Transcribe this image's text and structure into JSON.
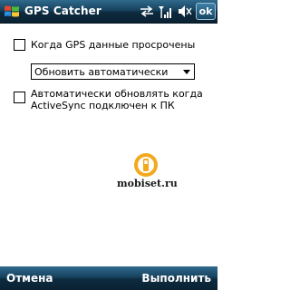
{
  "titlebar": {
    "title": "GPS Catcher",
    "ok_label": "ok",
    "icons": [
      "windows-start-icon",
      "connectivity-icon",
      "signal-icon",
      "volume-icon"
    ]
  },
  "options": {
    "gps_expired_label": "Когда GPS данные просрочены",
    "gps_expired_checked": false,
    "update_mode_selected": "Обновить автоматически",
    "activesync_label_line1": "Автоматически обновлять когда",
    "activesync_label_line2": "ActiveSync подключен к ПК",
    "activesync_checked": false
  },
  "watermark": {
    "text": "mobiset.ru"
  },
  "softkeys": {
    "left_label": "Отмена",
    "right_label": "Выполнить"
  }
}
